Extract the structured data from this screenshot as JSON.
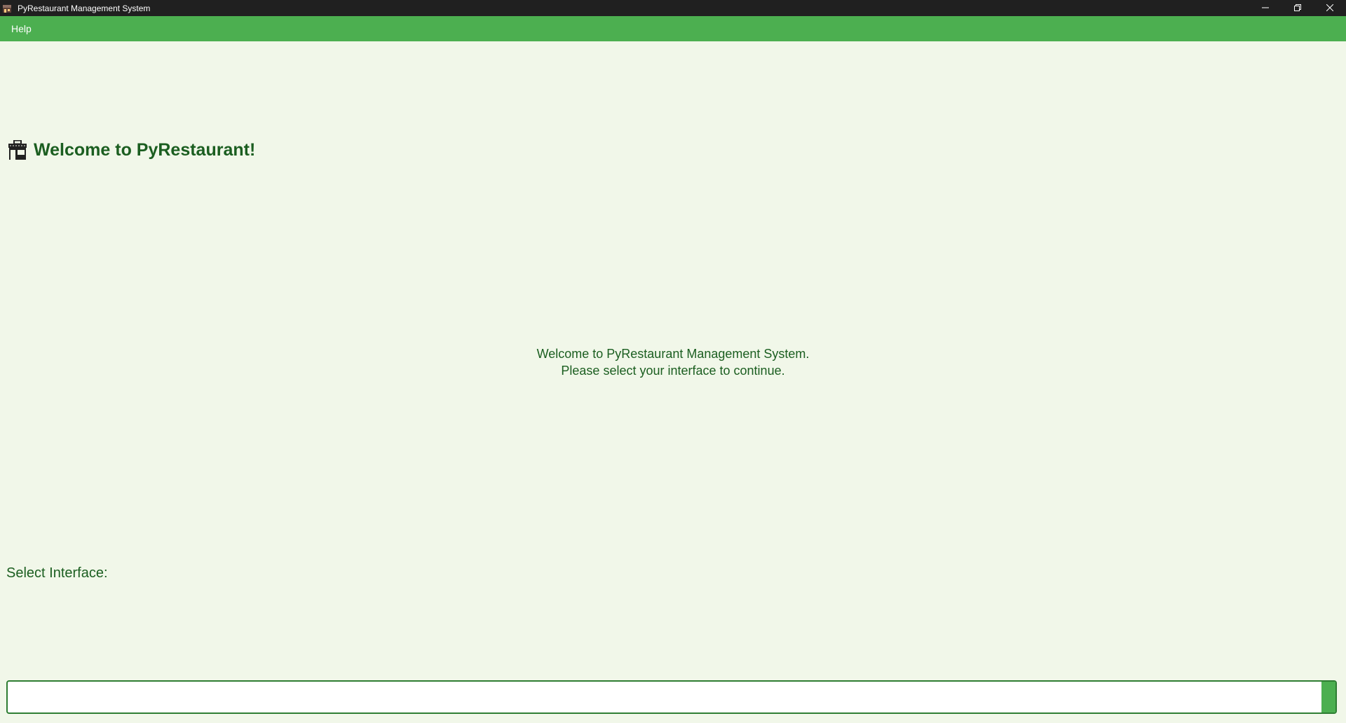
{
  "window": {
    "title": "PyRestaurant Management System",
    "app_icon": "restaurant-icon",
    "controls": {
      "minimize": "minimize-icon",
      "maximize": "restore-icon",
      "close": "close-icon"
    }
  },
  "menubar": {
    "items": [
      {
        "label": "Help"
      }
    ]
  },
  "main": {
    "title": "Welcome to PyRestaurant!",
    "title_icon": "restaurant-store-icon",
    "welcome_line1": "Welcome to PyRestaurant Management System.",
    "welcome_line2": "Please select your interface to continue.",
    "select_label": "Select Interface:",
    "interface_select": {
      "value": ""
    }
  },
  "colors": {
    "titlebar": "#202020",
    "menubar": "#4caf50",
    "background": "#f1f7e9",
    "text": "#1b5e20",
    "accent": "#2e7d32"
  }
}
